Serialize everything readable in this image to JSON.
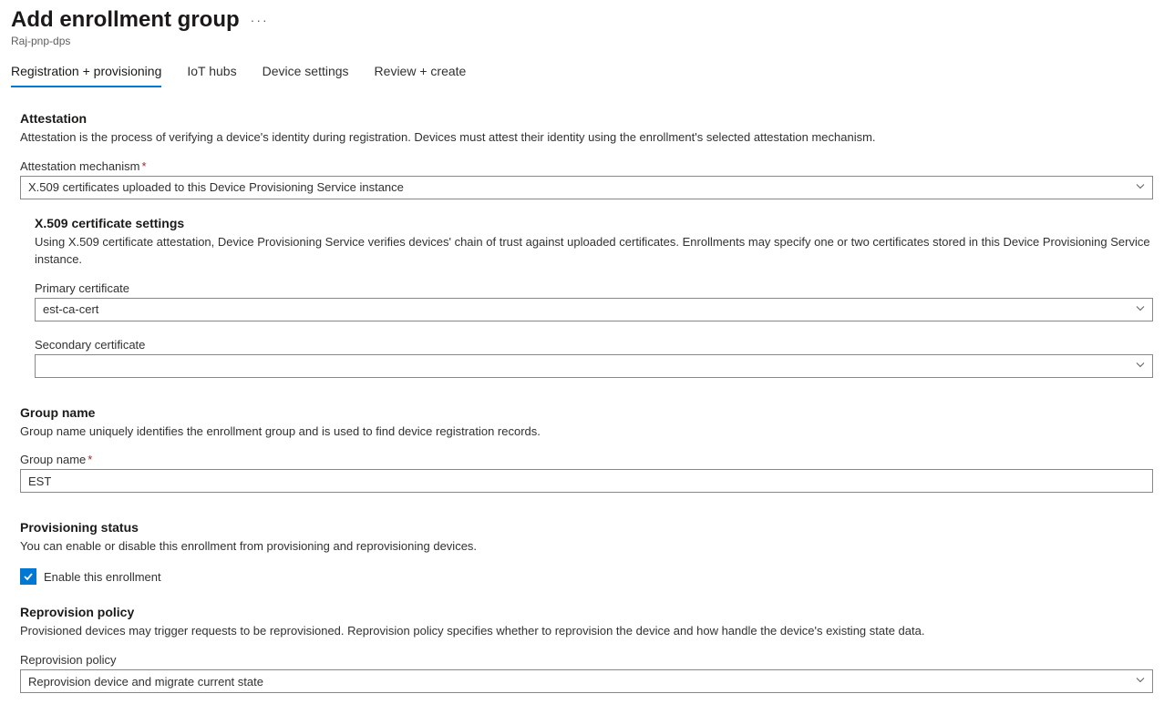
{
  "header": {
    "title": "Add enrollment group",
    "subtitle": "Raj-pnp-dps"
  },
  "tabs": [
    {
      "label": "Registration + provisioning",
      "active": true
    },
    {
      "label": "IoT hubs",
      "active": false
    },
    {
      "label": "Device settings",
      "active": false
    },
    {
      "label": "Review + create",
      "active": false
    }
  ],
  "attestation": {
    "heading": "Attestation",
    "desc": "Attestation is the process of verifying a device's identity during registration. Devices must attest their identity using the enrollment's selected attestation mechanism.",
    "mechanism_label": "Attestation mechanism",
    "mechanism_value": "X.509 certificates uploaded to this Device Provisioning Service instance"
  },
  "x509": {
    "heading": "X.509 certificate settings",
    "desc": "Using X.509 certificate attestation, Device Provisioning Service verifies devices' chain of trust against uploaded certificates. Enrollments may specify one or two certificates stored in this Device Provisioning Service instance.",
    "primary_label": "Primary certificate",
    "primary_value": "est-ca-cert",
    "secondary_label": "Secondary certificate",
    "secondary_value": ""
  },
  "group_name": {
    "heading": "Group name",
    "desc": "Group name uniquely identifies the enrollment group and is used to find device registration records.",
    "label": "Group name",
    "value": "EST"
  },
  "provisioning_status": {
    "heading": "Provisioning status",
    "desc": "You can enable or disable this enrollment from provisioning and reprovisioning devices.",
    "checkbox_label": "Enable this enrollment"
  },
  "reprovision": {
    "heading": "Reprovision policy",
    "desc": "Provisioned devices may trigger requests to be reprovisioned. Reprovision policy specifies whether to reprovision the device and how handle the device's existing state data.",
    "label": "Reprovision policy",
    "value": "Reprovision device and migrate current state"
  }
}
